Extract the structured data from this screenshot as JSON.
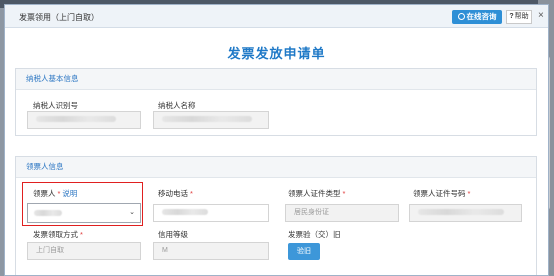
{
  "dialog": {
    "title": "发票领用（上门自取）",
    "online_consult": "在线咨询",
    "help_label": "帮助",
    "help_symbol": "?",
    "close_symbol": "×"
  },
  "page_heading": "发票发放申请单",
  "section_taxpayer": {
    "title": "纳税人基本信息",
    "fields": {
      "taxpayer_id_label": "纳税人识别号",
      "taxpayer_name_label": "纳税人名称"
    }
  },
  "section_receiver": {
    "title": "领票人信息",
    "receiver_label": "领票人",
    "receiver_required": "*",
    "receiver_explain_link": "说明",
    "mobile_label": "移动电话",
    "mobile_required": "*",
    "id_type_label": "领票人证件类型",
    "id_type_required": "*",
    "id_type_value": "居民身份证",
    "id_no_label": "领票人证件号码",
    "id_no_required": "*",
    "pickup_method_label": "发票领取方式",
    "pickup_method_required": "*",
    "pickup_method_value": "上门自取",
    "credit_level_label": "信用等级",
    "credit_level_value": "M",
    "verify_label": "发票验（交）旧",
    "verify_button": "验旧",
    "select_chevron": "⌄"
  },
  "colors": {
    "accent": "#2e8fd6",
    "heading": "#1f79c7",
    "required": "#e03a3a",
    "highlight_box": "#e02020"
  }
}
